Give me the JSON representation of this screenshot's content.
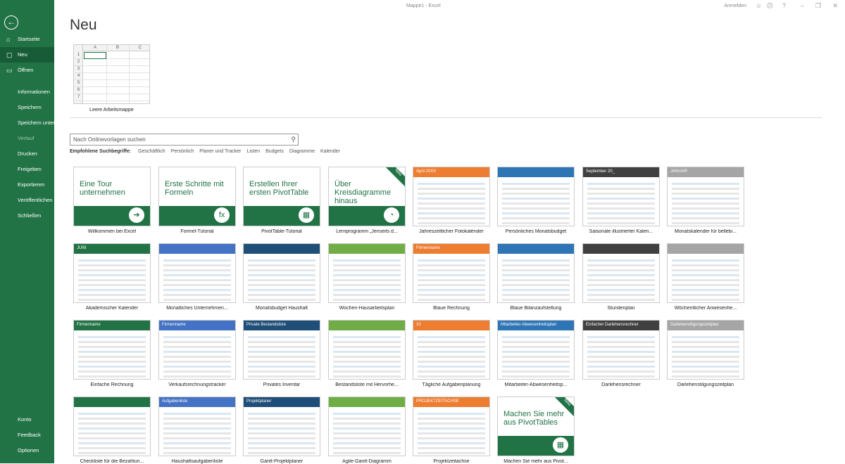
{
  "window": {
    "title": "Mappe1 - Excel",
    "signin": "Anmelden"
  },
  "sidebar": {
    "items": [
      "Startseite",
      "Neu",
      "Öffnen",
      "Informationen",
      "Speichern",
      "Speichern unter",
      "Verlauf",
      "Drucken",
      "Freigeben",
      "Exportieren",
      "Veröffentlichen",
      "Schließen"
    ],
    "bottom": [
      "Konto",
      "Feedback",
      "Optionen"
    ],
    "selected": "Neu"
  },
  "page": {
    "title": "Neu"
  },
  "blank": {
    "label": "Leere Arbeitsmappe",
    "cols": [
      "A",
      "B",
      "C"
    ],
    "rows": [
      "1",
      "2",
      "3",
      "4",
      "5",
      "6",
      "7"
    ]
  },
  "search": {
    "placeholder": "Nach Onlinevorlagen suchen",
    "suggest_label": "Empfohlene Suchbegriffe:",
    "suggestions": [
      "Geschäftlich",
      "Persönlich",
      "Planer und Tracker",
      "Listen",
      "Budgets",
      "Diagramme",
      "Kalender"
    ]
  },
  "templates": [
    {
      "label": "Willkommen bei Excel",
      "tut": "Eine Tour unternehmen",
      "icon": "➔"
    },
    {
      "label": "Formel-Tutorial",
      "tut": "Erste Schritte mit Formeln",
      "icon": "fx"
    },
    {
      "label": "PivotTable-Tutorial",
      "tut": "Erstellen Ihrer ersten PivotTable",
      "icon": "▦"
    },
    {
      "label": "Lernprogramm „Jenseits d...",
      "tut": "Über Kreisdiagramme hinaus",
      "icon": "◔",
      "ribbon": "Neu"
    },
    {
      "label": "Jahreszeitlicher Fotokalender",
      "head": "April 20XX"
    },
    {
      "label": "Persönliches Monatsbudget"
    },
    {
      "label": "Saisonale illustrierter Kalen...",
      "head": "September 20_"
    },
    {
      "label": "Monatskalender für bellebi...",
      "head": "JANUAR"
    },
    {
      "label": "Akademischer Kalender",
      "head": "JUNI"
    },
    {
      "label": "Monatliches Unternehmen..."
    },
    {
      "label": "Monatsbudget Haushalt"
    },
    {
      "label": "Wochen-Hausarbeitsplan"
    },
    {
      "label": "Blaue Rechnung",
      "head": "Firmenname"
    },
    {
      "label": "Blaue Bilanzaufstellung"
    },
    {
      "label": "Stundenplan"
    },
    {
      "label": "Wöchentlicher Anwesenhe..."
    },
    {
      "label": "Einfache Rechnung",
      "head": "Firmenname"
    },
    {
      "label": "Verkaufsrechnungstracker",
      "head": "Firmenname"
    },
    {
      "label": "Privates Inventar",
      "head": "Private Bestandsliste"
    },
    {
      "label": "Bestandsliste mit Hervorhe..."
    },
    {
      "label": "Tägliche Aufgabenplanung",
      "head": "10"
    },
    {
      "label": "Mitarbeiter-Abwesenheitsp...",
      "head": "Mitarbeiter-Abwesenheitsplan"
    },
    {
      "label": "Darlehensrechner",
      "head": "Einfacher Darlehensrechner"
    },
    {
      "label": "Darlehenstilgungszeitplan",
      "head": "Darlehenstilgungszeitplan"
    },
    {
      "label": "Checkliste für die Bezahlun..."
    },
    {
      "label": "Haushaltsaufgabenliste",
      "head": "Aufgabenliste"
    },
    {
      "label": "Gantt-Projektplaner",
      "head": "Projektplaner"
    },
    {
      "label": "Agile-Gantt-Diagramm"
    },
    {
      "label": "Projektzeitachse",
      "head": "PROJEKTZEITACHSE"
    },
    {
      "label": "Machen Sie mehr aus Pivot...",
      "tut": "Machen Sie mehr aus PivotTables",
      "icon": "▦",
      "ribbon": "Neu"
    }
  ],
  "colors": {
    "accent": "#217346"
  }
}
